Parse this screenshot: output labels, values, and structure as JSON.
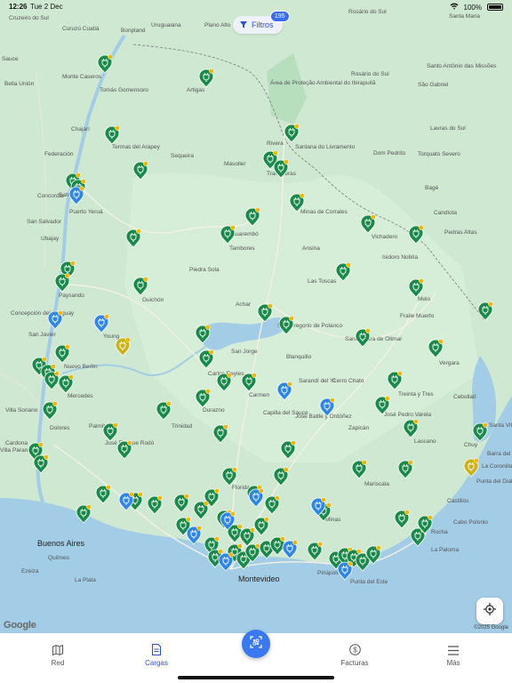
{
  "status_bar": {
    "time": "12:26",
    "date": "Tue 2 Dec",
    "battery": "100%"
  },
  "filters": {
    "label": "Filtros",
    "count": "195"
  },
  "map": {
    "attribution": "Google",
    "copyright": "©2025 Google",
    "labels": [
      "Cruzeiro do Sul",
      "Curuzú Cuatiá",
      "Bonpland",
      "Uruguaiana",
      "Plano Alto",
      "Rosário do Sul",
      "Dom Pedrito",
      "Santa Maria",
      "Sauce",
      "Monte Caseros",
      "Bella Unión",
      "Tomás Gomensoro",
      "Artigas",
      "Área de Proteção Ambiental do Ibirapuitã",
      "Chajarí",
      "Termas del Arapey",
      "Federación",
      "Sequeira",
      "Masoller",
      "Rivera",
      "Santana do Livramento",
      "Concordia",
      "Salto",
      "Tranqueras",
      "Minas de Corrales",
      "Puerto Yeruá",
      "San Salvador",
      "Ubajay",
      "Tacuarembó",
      "Tambores",
      "Ansina",
      "Vichadero",
      "Piedra Sola",
      "Las Toscas",
      "Paysandú",
      "Guichón",
      "Concepción del Uruguay",
      "San Javier",
      "Young",
      "Nuevo Berlín",
      "Mercedes",
      "Achar",
      "San Gregorio de Polanco",
      "Blanquillo",
      "San Jorge",
      "Melo",
      "Fraile Muerto",
      "Santa Clara de Olimar",
      "Carlos Reyles",
      "Carmen",
      "Sarandí del Yí",
      "Cerro Chato",
      "Treinta y Tres",
      "Vergara",
      "Durazno",
      "Capilla del Sauce",
      "José Batlle y Ordóñez",
      "Zapicán",
      "José Pedro Varela",
      "Lascano",
      "Cebollatí",
      "Chuy",
      "Santa Vitória do Palmar",
      "Villa Soriano",
      "Palmitas",
      "Dolores",
      "Trinidad",
      "Florida",
      "Cardona",
      "José Enrique Rodó",
      "Mariscala",
      "Barra del Chuy",
      "La Coronilla",
      "Punta del Diablo",
      "Castillos",
      "Minas",
      "Rocha",
      "Cabo Polonio",
      "La Paloma",
      "Buenos Aires",
      "Quilmes",
      "La Plata",
      "Ezeiza",
      "Montevideo",
      "Piriápolis",
      "Punta del Este",
      "Las Piedras",
      "Villa Paranacito",
      "Isidoro Noblía",
      "Candiota",
      "Pedras Altas",
      "Bagé",
      "Torquato Severo",
      "Lavras do Sul",
      "São Gabriel",
      "Rosário do Sul",
      "Santo Antônio das Missões"
    ],
    "charger_markers": [
      {
        "status": "available",
        "color": "#1a8a4a"
      },
      {
        "status": "busy",
        "color": "#2f86e8"
      },
      {
        "status": "limited",
        "color": "#c9b31a"
      }
    ]
  },
  "locate_button": {
    "icon": "crosshair-icon"
  },
  "tabbar": {
    "tabs": [
      {
        "label": "Red",
        "icon": "map-icon"
      },
      {
        "label": "Cargas",
        "icon": "receipt-icon"
      },
      {
        "label": "Facturas",
        "icon": "dollar-icon"
      },
      {
        "label": "Más",
        "icon": "menu-icon"
      }
    ],
    "fab_icon": "qr-scan-icon"
  }
}
